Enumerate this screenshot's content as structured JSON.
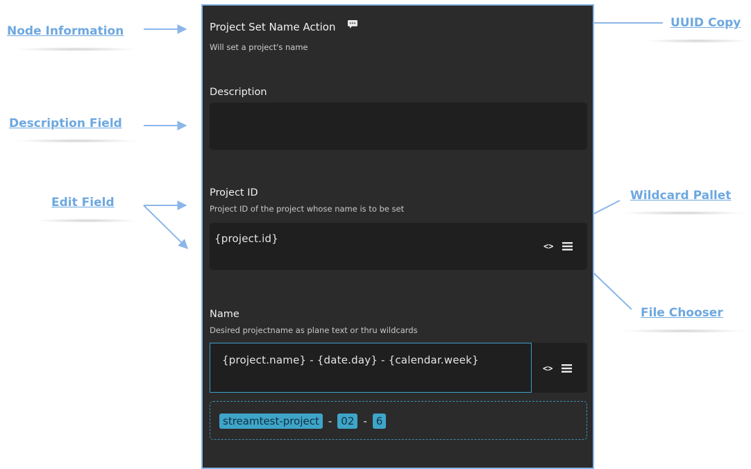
{
  "panel": {
    "title": "Project Set Name Action",
    "subtitle": "Will set a project's name",
    "description": {
      "label": "Description",
      "value": ""
    },
    "project_id": {
      "label": "Project ID",
      "help": "Project ID of the project whose name is to be set",
      "value": "{project.id}"
    },
    "name": {
      "label": "Name",
      "help": "Desired projectname as plane text or thru wildcards",
      "value": "{project.name} - {date.day} - {calendar.week}"
    },
    "preview": {
      "chips": [
        "streamtest-project",
        "02",
        "6"
      ],
      "separator": "-"
    },
    "icons": {
      "copy": "message-icon",
      "wildcard": "code-brackets-icon",
      "file": "list-icon"
    }
  },
  "callouts": {
    "node_information": "Node Information",
    "description_field": "Description Field",
    "edit_field": "Edit Field",
    "uuid_copy": "UUID Copy",
    "wildcard_pallet": "Wildcard Pallet",
    "file_chooser": "File Chooser"
  },
  "colors": {
    "panel_bg": "#2b2b2b",
    "field_bg": "#1f1f1f",
    "accent": "#3ea5c9",
    "callout": "#6da8e0",
    "panel_border": "#8bb6e8"
  }
}
